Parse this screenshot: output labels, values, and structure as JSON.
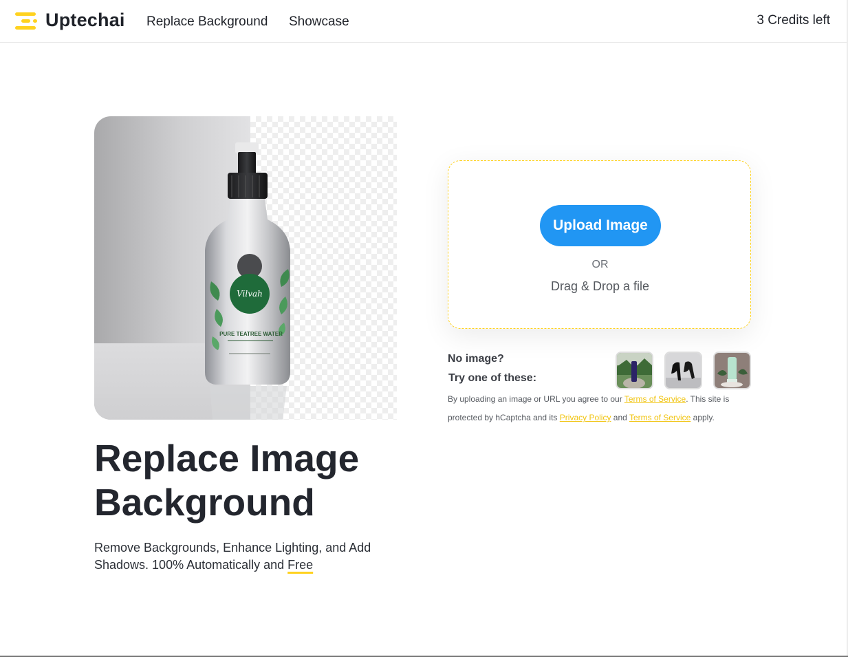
{
  "header": {
    "brand": "Uptechai",
    "nav": [
      "Replace Background",
      "Showcase"
    ],
    "credits": "3 Credits left"
  },
  "hero": {
    "product_label_brand": "Vilvah",
    "product_label_name": "PURE TEATREE WATER"
  },
  "main": {
    "title_line1": "Replace Image",
    "title_line2": "Background",
    "subtitle": "Remove Backgrounds, Enhance Lighting, and Add Shadows. 100% Automatically and ",
    "subtitle_emphasis": "Free"
  },
  "upload": {
    "button_label": "Upload Image",
    "or_text": "OR",
    "drag_text": "Drag & Drop a file"
  },
  "samples": {
    "no_image": "No image?",
    "try_one": "Try one of these:",
    "thumbnails": [
      "sample-tube-on-rock",
      "sample-black-heels",
      "sample-green-tube"
    ]
  },
  "legal": {
    "prefix": "By uploading an image or URL you agree to our ",
    "terms_link": "Terms of Service",
    "middle": ". This site is protected by hCaptcha and its ",
    "privacy_link": "Privacy Policy",
    "and": " and ",
    "terms_link2": "Terms of Service",
    "suffix": " apply."
  },
  "colors": {
    "accent_yellow": "#ffd21f",
    "primary_blue": "#2196f3",
    "text_dark": "#23262e"
  }
}
